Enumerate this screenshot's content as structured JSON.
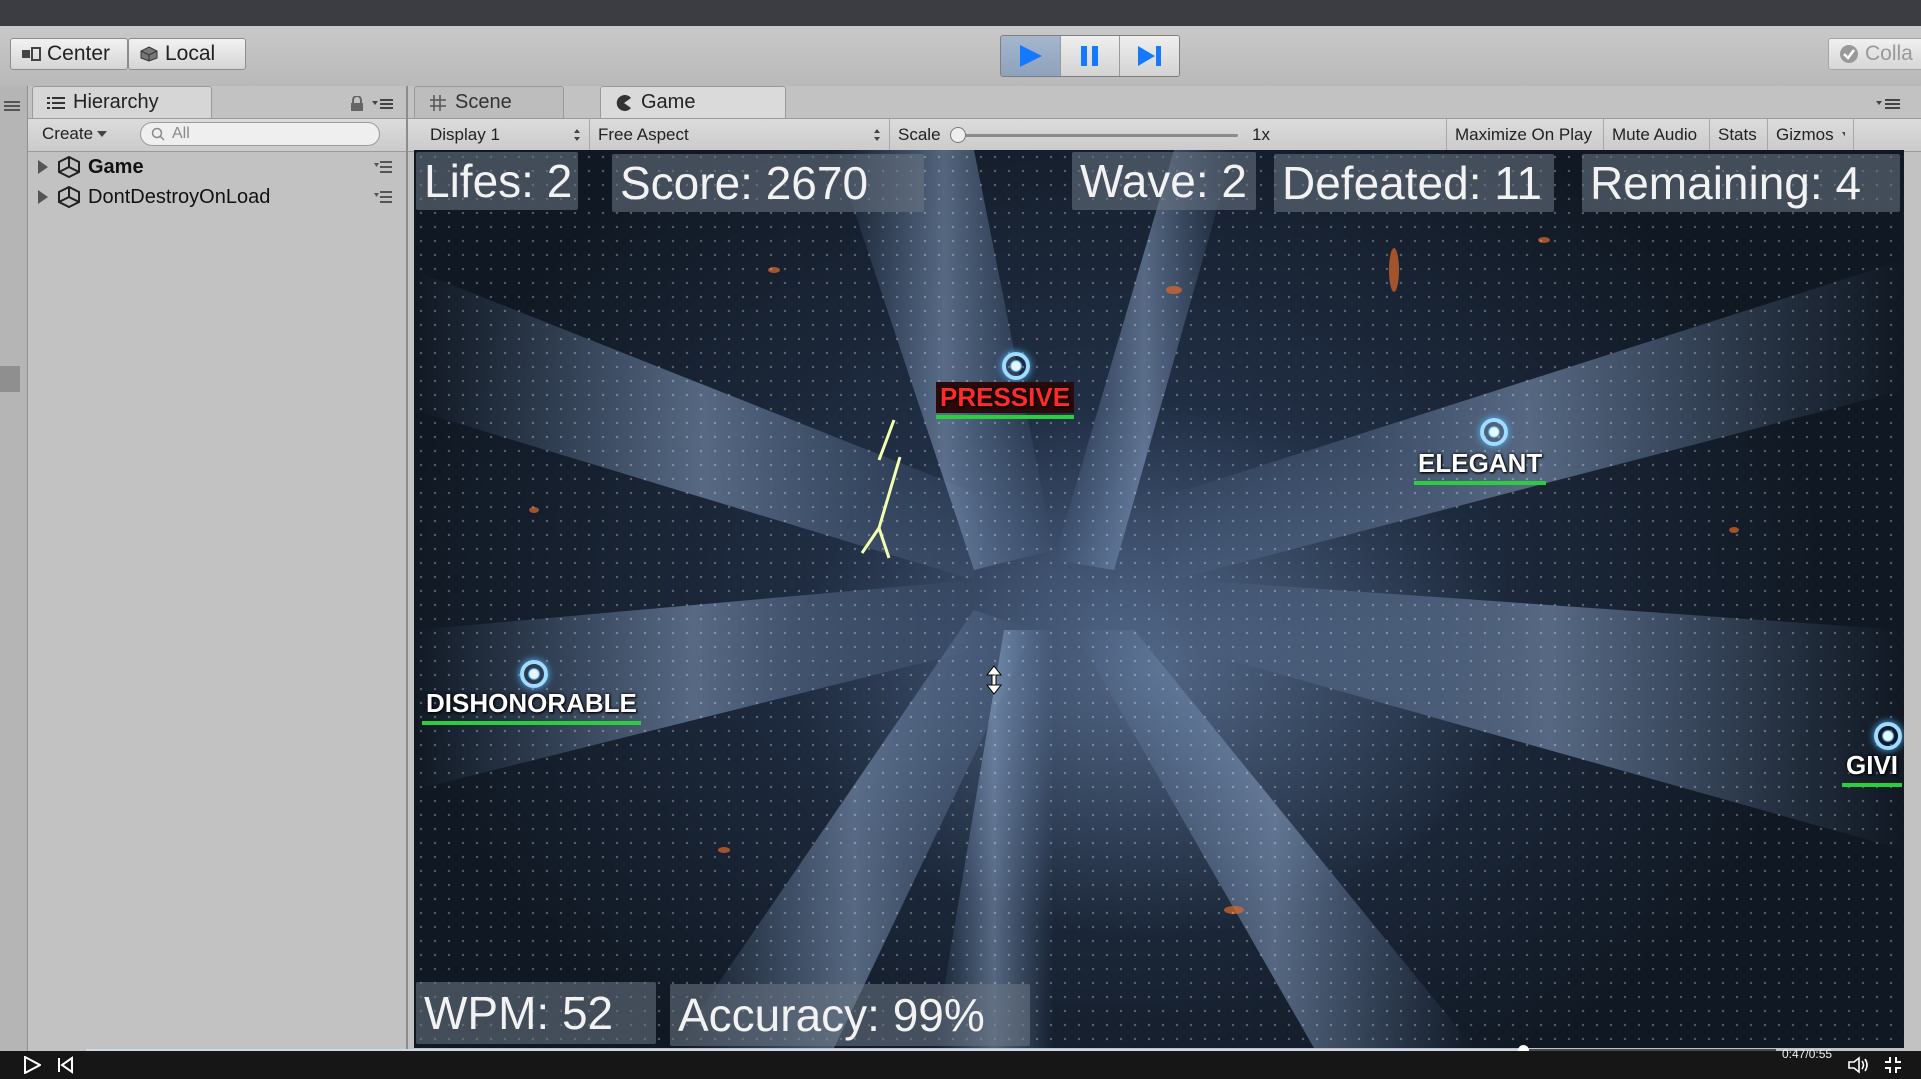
{
  "toolbar": {
    "center_label": "Center",
    "local_label": "Local",
    "collab_label": "Colla"
  },
  "hierarchy": {
    "tab_label": "Hierarchy",
    "create_label": "Create",
    "search_placeholder": "All",
    "items": [
      {
        "label": "Game"
      },
      {
        "label": "DontDestroyOnLoad"
      }
    ]
  },
  "game_panel": {
    "scene_tab": "Scene",
    "game_tab": "Game",
    "display_label": "Display 1",
    "aspect_label": "Free Aspect",
    "scale_label": "Scale",
    "scale_value": "1x",
    "maximize_label": "Maximize On Play",
    "mute_label": "Mute Audio",
    "stats_label": "Stats",
    "gizmos_label": "Gizmos"
  },
  "hud": {
    "lifes": "Lifes: 2",
    "score": "Score: 2670",
    "wave": "Wave: 2",
    "defeated": "Defeated: 11",
    "remaining": "Remaining: 4",
    "wpm": "WPM: 52",
    "accuracy": "Accuracy: 99%"
  },
  "enemies": [
    {
      "word": "PRESSIVE",
      "state": "targeted"
    },
    {
      "word": "ELEGANT",
      "state": "normal"
    },
    {
      "word": "DISHONORABLE",
      "state": "normal"
    },
    {
      "word": "GIVI",
      "state": "normal"
    }
  ],
  "video": {
    "time": "0:47/0:55",
    "progress": 0.85
  },
  "colors": {
    "editor_bg": "#c2c2c2",
    "play_active": "#8da2bd",
    "enemy_targeted": "#ff2a2a",
    "enemy_health": "#2ecc40"
  }
}
